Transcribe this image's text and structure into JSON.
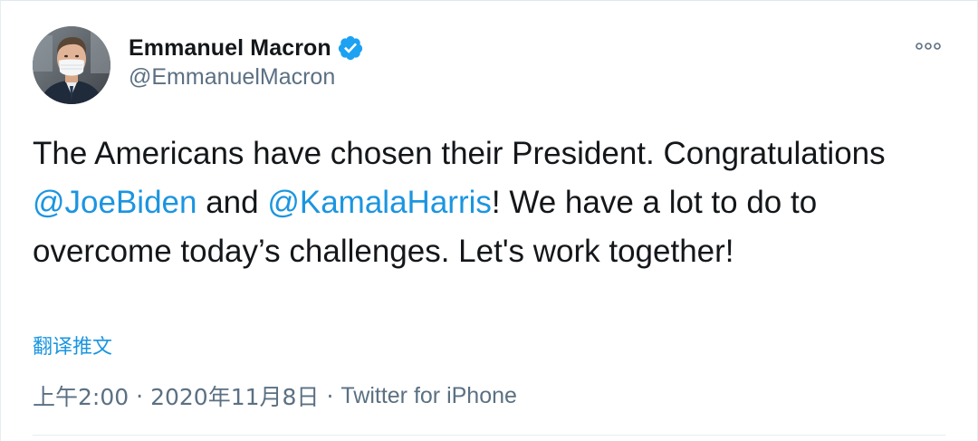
{
  "author": {
    "display_name": "Emmanuel Macron",
    "handle": "@EmmanuelMacron",
    "verified": true,
    "avatar": "profile-photo"
  },
  "tweet": {
    "parts": [
      {
        "type": "text",
        "value": "The Americans have chosen their President. Congratulations "
      },
      {
        "type": "mention",
        "value": "@JoeBiden"
      },
      {
        "type": "text",
        "value": " and "
      },
      {
        "type": "mention",
        "value": "@KamalaHarris"
      },
      {
        "type": "text",
        "value": "! We have a lot to do to overcome today’s challenges. Let's work together!"
      }
    ]
  },
  "translate_label": "翻译推文",
  "meta": {
    "time": "上午2:00",
    "separator": "·",
    "date": "2020年11月8日",
    "source": "Twitter for iPhone"
  },
  "colors": {
    "accent": "#1b95e0",
    "verified_badge": "#1da1f2",
    "secondary_text": "#5b7083",
    "primary_text": "#14171a",
    "border": "#e6ecf0"
  },
  "icons": {
    "verified": "verified-badge-icon",
    "more": "more-options-icon"
  }
}
